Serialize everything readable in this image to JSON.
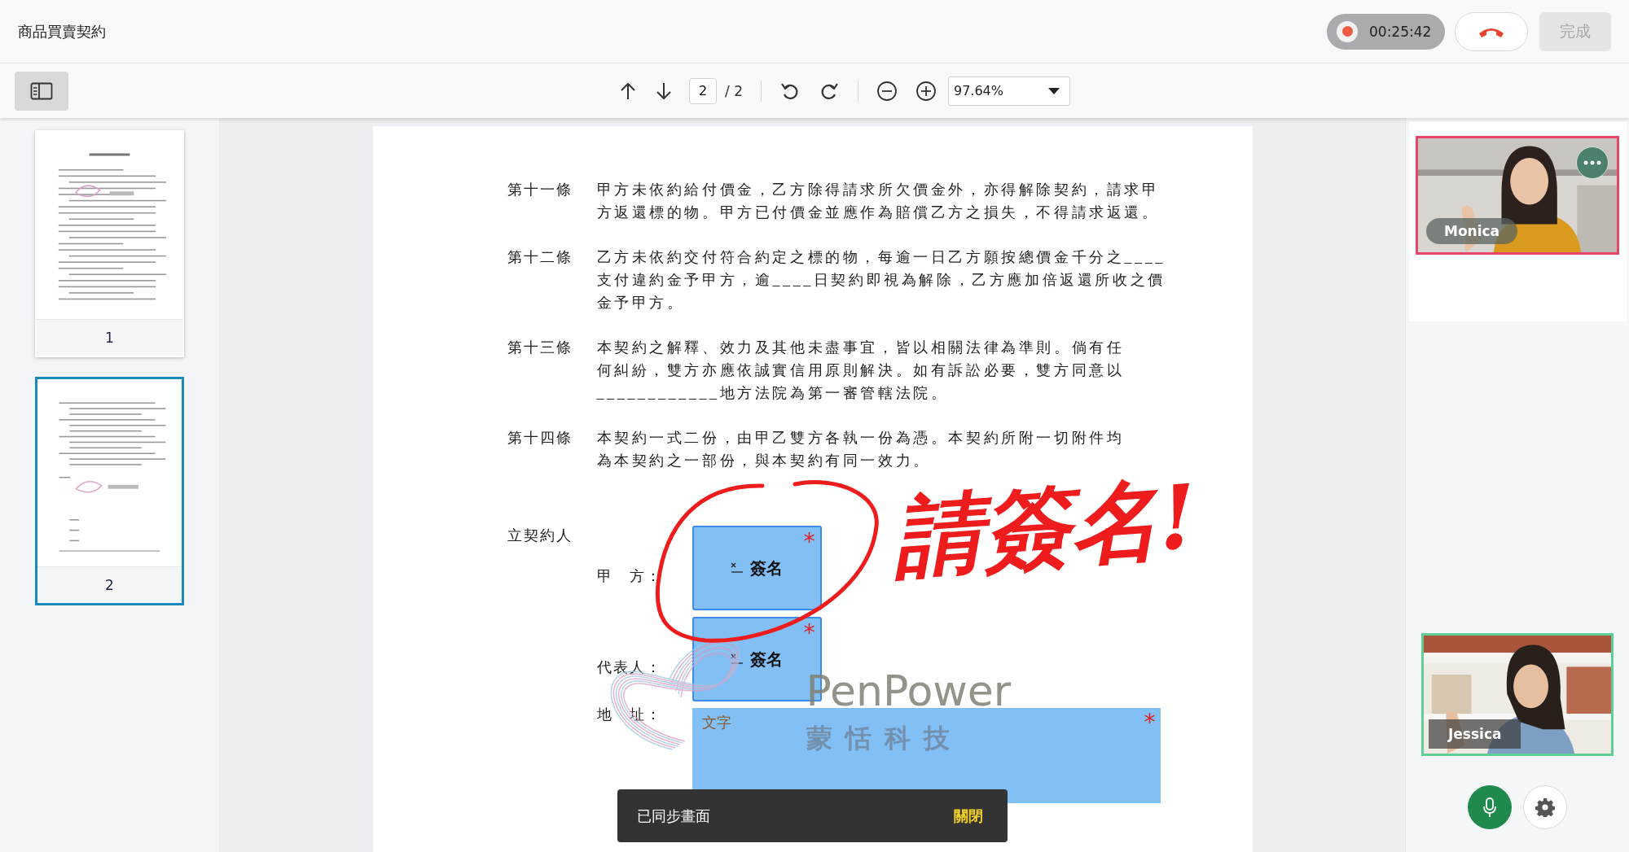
{
  "header": {
    "title": "商品買賣契約",
    "recording": {
      "on": true,
      "time": "00:25:42"
    },
    "finish_button": {
      "label": "完成",
      "disabled": true
    }
  },
  "toolbar": {
    "page_input": "2",
    "page_total": "/ 2",
    "zoom": "97.64%"
  },
  "thumbnails": [
    {
      "page": "1",
      "selected": false
    },
    {
      "page": "2",
      "selected": true
    }
  ],
  "document": {
    "articles": [
      {
        "label": "第十一條",
        "lines": [
          "甲方未依約給付價金，乙方除得請求所欠價金外，亦得解除契約，請求甲",
          "方返還標的物。甲方已付價金並應作為賠償乙方之損失，不得請求返還。"
        ]
      },
      {
        "label": "第十二條",
        "lines": [
          "乙方未依約交付符合約定之標的物，每逾一日乙方願按總價金千分之____",
          "支付違約金予甲方，逾____日契約即視為解除，乙方應加倍返還所收之價",
          "金予甲方。"
        ]
      },
      {
        "label": "第十三條",
        "lines": [
          "本契約之解釋、效力及其他未盡事宜，皆以相關法律為準則。倘有任",
          "何糾紛，雙方亦應依誠實信用原則解決。如有訴訟必要，雙方同意以",
          "____________地方法院為第一審管轄法院。"
        ]
      },
      {
        "label": "第十四條",
        "lines": [
          "本契約一式二份，由甲乙雙方各執一份為憑。本契約所附一切附件均",
          "為本契約之一部份，與本契約有同一效力。"
        ]
      }
    ],
    "signatory_heading": "立契約人",
    "fields": [
      {
        "label": "甲　方：",
        "kind": "signature",
        "field_label": "簽名",
        "required_mark": "*"
      },
      {
        "label": "代表人：",
        "kind": "signature",
        "field_label": "簽名",
        "required_mark": "*"
      },
      {
        "label": "地　址：",
        "kind": "text",
        "placeholder": "文字",
        "required_mark": "*"
      }
    ],
    "logo": {
      "name": "PenPower",
      "subtitle": "蒙恬科技"
    },
    "annotation": "請簽名!"
  },
  "participants": [
    {
      "name": "Monica",
      "color": "#e8456b"
    },
    {
      "name": "Jessica",
      "color": "#5fcf95"
    }
  ],
  "toast": {
    "message": "已同步畫面",
    "action": "關閉"
  }
}
